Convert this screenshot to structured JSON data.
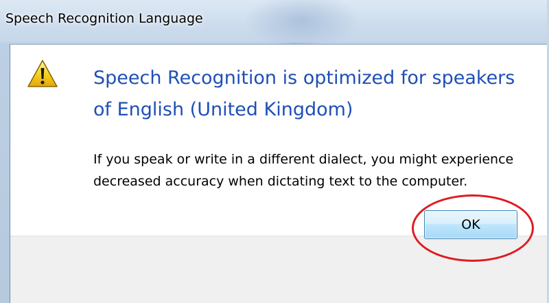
{
  "window": {
    "title": "Speech Recognition Language"
  },
  "dialog": {
    "icon": "warning-icon",
    "main_instruction": "Speech Recognition is optimized for speakers of English (United Kingdom)",
    "content": "If you speak or write in a different dialect, you might experience decreased accuracy when dictating text to the computer.",
    "ok_label": "OK"
  },
  "colors": {
    "main_instruction": "#1f4fb5",
    "annotation": "#e01a22",
    "footer_bg": "#f0f0f0"
  }
}
